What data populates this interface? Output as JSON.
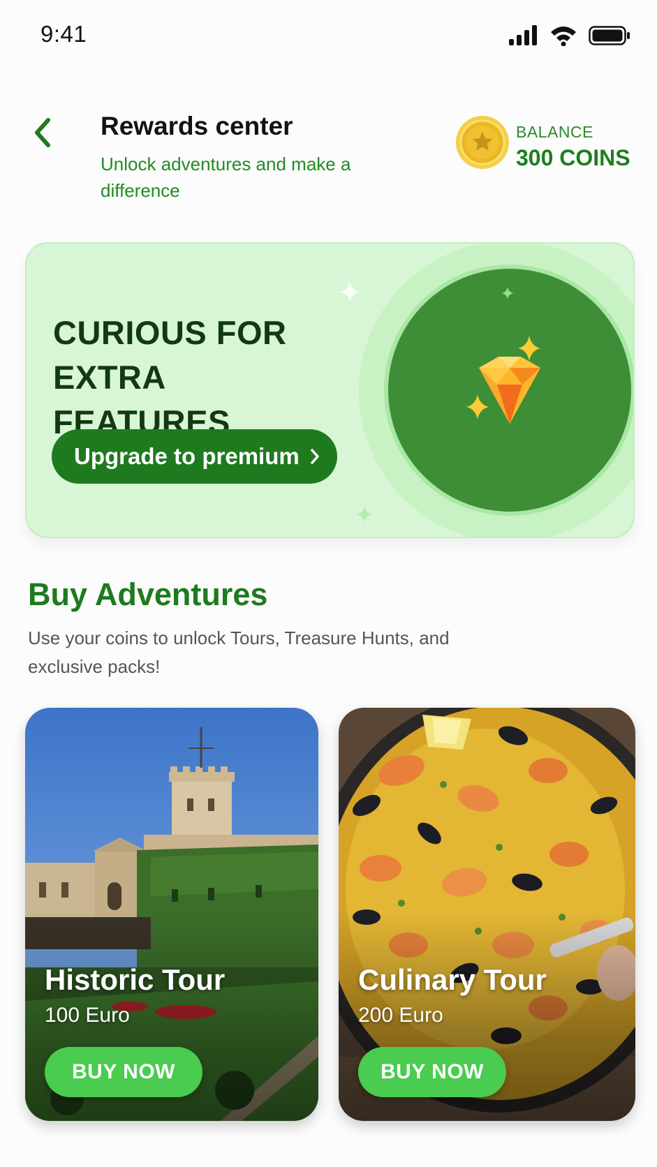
{
  "status_bar": {
    "time": "9:41"
  },
  "header": {
    "title": "Rewards center",
    "subtitle": "Unlock adventures and make a difference",
    "balance_label": "BALANCE",
    "balance_value": "300 COINS"
  },
  "banner": {
    "headline": "CURIOUS FOR EXTRA FEATURES",
    "button_label": "Upgrade to premium"
  },
  "section": {
    "title": "Buy Adventures",
    "description": "Use your coins to unlock Tours, Treasure Hunts, and exclusive packs!"
  },
  "cards": [
    {
      "title": "Historic Tour",
      "price": "100 Euro",
      "button_label": "BUY NOW",
      "image": "castle-photo"
    },
    {
      "title": "Culinary Tour",
      "price": "200 Euro",
      "button_label": "BUY NOW",
      "image": "paella-photo"
    }
  ],
  "colors": {
    "brand_green": "#1f7a1f",
    "accent_green": "#49cc4f",
    "banner_bg": "#d8f6d6",
    "circle_green": "#3e8e37",
    "coin_gold": "#f2c230"
  }
}
